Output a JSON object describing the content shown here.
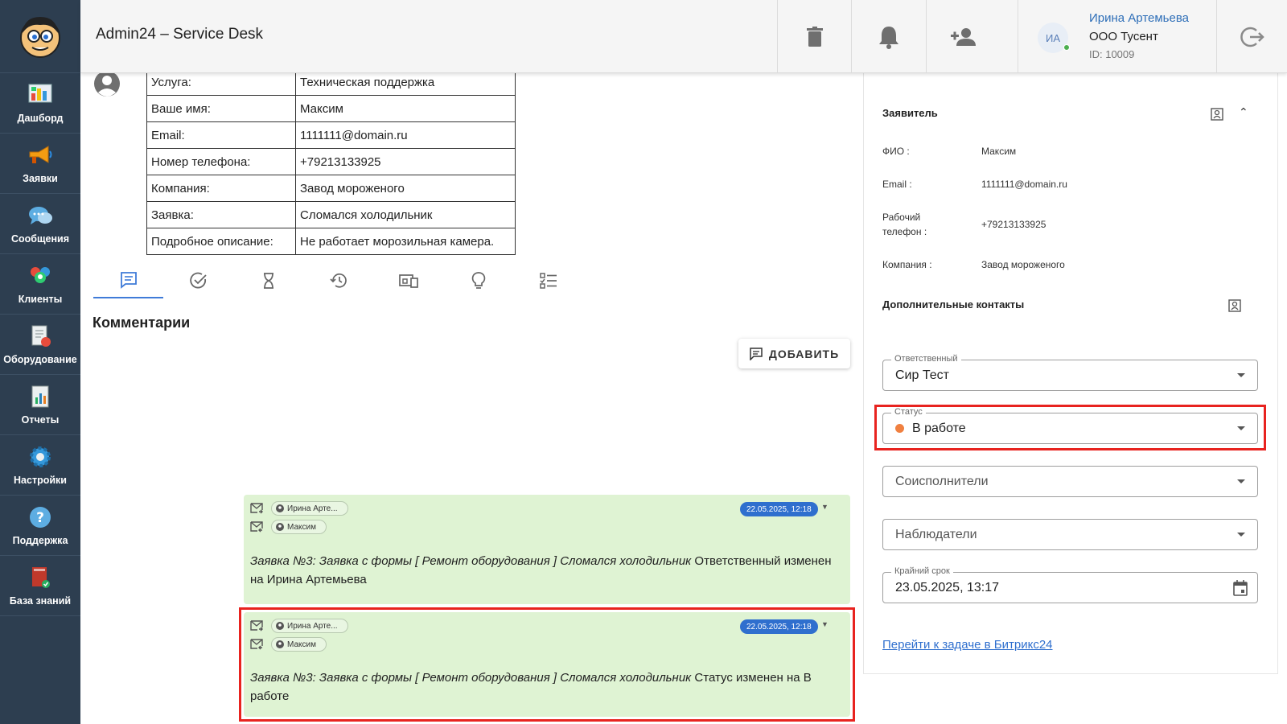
{
  "colors": {
    "sidebar_bg": "#2d3e50",
    "accent": "#3f7bd8",
    "message_bg": "#dff3d3",
    "highlight": "#e8231f",
    "status_dot": "#f08040"
  },
  "header": {
    "app_title": "Admin24 – Service Desk",
    "actions": [
      "trash-icon",
      "bell-icon",
      "add-user-icon",
      "logout-icon"
    ],
    "user": {
      "initials": "ИА",
      "name": "Ирина Артемьева",
      "company": "ООО Тусент",
      "id_label": "ID: 10009"
    }
  },
  "sidebar": {
    "items": [
      {
        "label": "Дашборд",
        "icon": "dashboard-icon"
      },
      {
        "label": "Заявки",
        "icon": "megaphone-icon"
      },
      {
        "label": "Сообщения",
        "icon": "chat-icon"
      },
      {
        "label": "Клиенты",
        "icon": "clients-icon"
      },
      {
        "label": "Оборудование",
        "icon": "equipment-icon"
      },
      {
        "label": "Отчеты",
        "icon": "reports-icon"
      },
      {
        "label": "Настройки",
        "icon": "settings-icon"
      },
      {
        "label": "Поддержка",
        "icon": "support-icon"
      },
      {
        "label": "База знаний",
        "icon": "knowledge-base-icon"
      }
    ]
  },
  "request_table": {
    "rows": [
      {
        "key": "Услуга:",
        "value": "Техническая поддержка"
      },
      {
        "key": "Ваше имя:",
        "value": "Максим"
      },
      {
        "key": "Email:",
        "value": "1111111@domain.ru"
      },
      {
        "key": "Номер телефона:",
        "value": "+79213133925"
      },
      {
        "key": "Компания:",
        "value": "Завод мороженого"
      },
      {
        "key": "Заявка:",
        "value": "Сломался холодильник"
      },
      {
        "key": "Подробное описание:",
        "value": "Не работает морозильная камера."
      }
    ]
  },
  "tabs": [
    "comments-tab-icon",
    "check-tab-icon",
    "hourglass-tab-icon",
    "history-tab-icon",
    "devices-tab-icon",
    "idea-tab-icon",
    "checklist-tab-icon"
  ],
  "comments": {
    "title": "Комментарии",
    "add_label": "ДОБАВИТЬ",
    "messages": [
      {
        "from": "Ирина Арте...",
        "to": "Максим",
        "date": "22.05.2025, 12:18",
        "text_italic": "Заявка №3: Заявка с формы [ Ремонт оборудования ] Сломался холодильник",
        "text_plain": " Ответственный изменен на Ирина Артемьева"
      },
      {
        "from": "Ирина Арте...",
        "to": "Максим",
        "date": "22.05.2025, 12:18",
        "text_italic": "Заявка №3: Заявка с формы [ Ремонт оборудования ] Сломался холодильник",
        "text_plain": " Статус изменен на В работе"
      }
    ]
  },
  "applicant": {
    "title": "Заявитель",
    "fio_label": "ФИО :",
    "fio": "Максим",
    "email_label": "Email :",
    "email": "1111111@domain.ru",
    "phone_label_1": "Рабочий",
    "phone_label_2": "телефон :",
    "phone": "+79213133925",
    "company_label": "Компания :",
    "company": "Завод мороженого"
  },
  "extra_contacts": {
    "title": "Дополнительные контакты"
  },
  "form": {
    "responsible_label": "Ответственный",
    "responsible_value": "Сир Тест",
    "status_label": "Статус",
    "status_value": "В работе",
    "coexecutors_placeholder": "Соисполнители",
    "observers_placeholder": "Наблюдатели",
    "deadline_label": "Крайний срок",
    "deadline_value": "23.05.2025, 13:17"
  },
  "bitrix_link": "Перейти к задаче в Битрикс24"
}
